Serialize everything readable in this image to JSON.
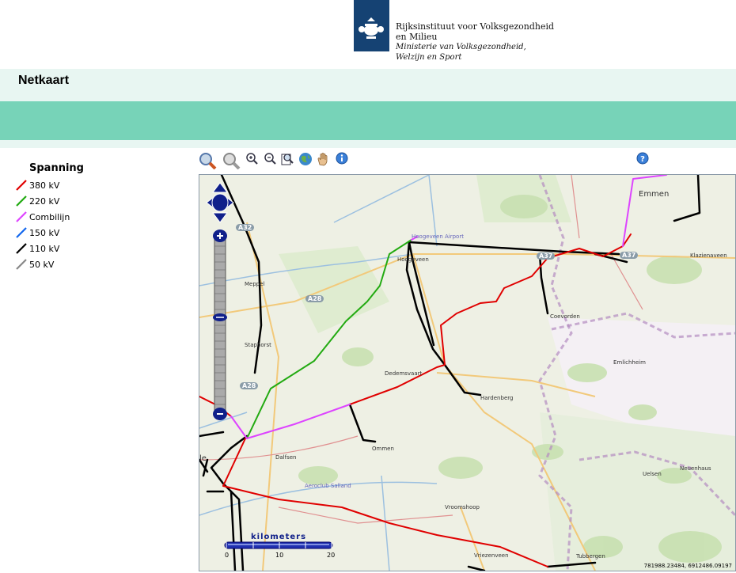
{
  "header": {
    "org_line1": "Rijksinstituut voor Volksgezondheid",
    "org_line2": "en Milieu",
    "org_line3": "Ministerie van Volksgezondheid,",
    "org_line4": "Welzijn en Sport",
    "title": "Netkaart"
  },
  "legend": {
    "heading": "Spanning",
    "items": [
      {
        "label": "380 kV",
        "color": "#e00000"
      },
      {
        "label": "220 kV",
        "color": "#22aa11"
      },
      {
        "label": "Combilijn",
        "color": "#dd44ff"
      },
      {
        "label": "150 kV",
        "color": "#1166ee"
      },
      {
        "label": "110 kV",
        "color": "#000000"
      },
      {
        "label": "50 kV",
        "color": "#888888"
      }
    ]
  },
  "toolbar": {
    "icons": [
      "zoom-in-box-icon",
      "zoom-out-box-icon",
      "zoom-in-icon",
      "zoom-out-icon",
      "zoom-extent-icon",
      "globe-icon",
      "pan-hand-icon",
      "info-icon",
      "help-icon"
    ]
  },
  "map": {
    "places": [
      "Emmen",
      "Hoogeveen",
      "Hoogeveen Airport",
      "Klazienaveen",
      "Meppel",
      "Staphorst",
      "Coevorden",
      "Emlichheim",
      "Dedemsvaart",
      "Hardenberg",
      "Ommen",
      "Dalfsen",
      "Aeroclub Salland",
      "Vroomshoop",
      "Uelsen",
      "Neuenhaus",
      "Vriezenveen",
      "Tubbergen",
      "le"
    ],
    "roads": [
      "A32",
      "A28",
      "A28",
      "A37",
      "A37"
    ],
    "scale": {
      "unit": "kilometers",
      "ticks": [
        "0",
        "10",
        "20"
      ]
    },
    "coordinates": "781988.23484, 6912486.09197"
  }
}
